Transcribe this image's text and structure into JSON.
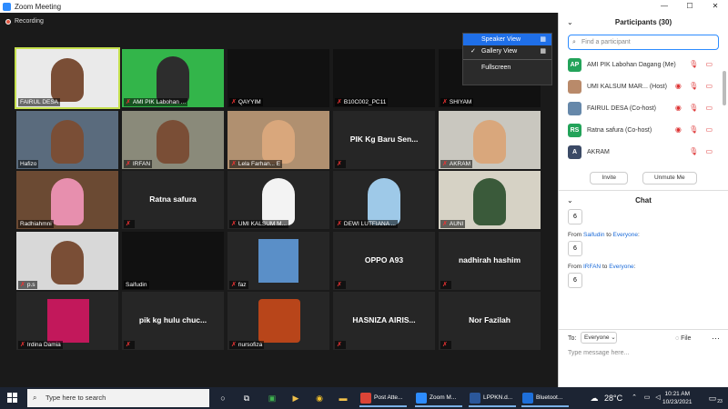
{
  "window": {
    "title": "Zoom Meeting",
    "minimize": "—",
    "maximize": "☐",
    "close": "✕"
  },
  "recording": {
    "label": "Recording"
  },
  "view_menu": {
    "items": [
      {
        "label": "Speaker View",
        "selected": true,
        "checked": false,
        "icon": "▦"
      },
      {
        "label": "Gallery View",
        "selected": false,
        "checked": true,
        "icon": "▦"
      },
      {
        "label": "Fullscreen",
        "selected": false,
        "checked": false,
        "icon": ""
      }
    ]
  },
  "tiles": [
    {
      "name": "FAIRUL DESA",
      "muted": false,
      "center": "",
      "active": true
    },
    {
      "name": "AMI PIK Labohan ...",
      "muted": true,
      "center": ""
    },
    {
      "name": "QAYYIM",
      "muted": true,
      "center": ""
    },
    {
      "name": "B10C002_PC11",
      "muted": true,
      "center": ""
    },
    {
      "name": "SHIYAM",
      "muted": true,
      "center": ""
    },
    {
      "name": "Hafizo",
      "muted": false,
      "center": ""
    },
    {
      "name": "IRFAN",
      "muted": true,
      "center": ""
    },
    {
      "name": "Lela Farhan...  E",
      "muted": true,
      "center": ""
    },
    {
      "name": "",
      "muted": true,
      "center": "PIK Kg Baru Sen..."
    },
    {
      "name": "AKRAM",
      "muted": true,
      "center": ""
    },
    {
      "name": "Radhiahmni",
      "muted": false,
      "center": ""
    },
    {
      "name": "",
      "muted": true,
      "center": "Ratna safura"
    },
    {
      "name": "UMI KALSUM M...",
      "muted": true,
      "center": ""
    },
    {
      "name": "DEWI LUTFIANA ...",
      "muted": true,
      "center": ""
    },
    {
      "name": "AUNI",
      "muted": true,
      "center": ""
    },
    {
      "name": "p.s",
      "muted": true,
      "center": ""
    },
    {
      "name": "Saifudin",
      "muted": false,
      "center": ""
    },
    {
      "name": "faz",
      "muted": true,
      "center": ""
    },
    {
      "name": "",
      "muted": true,
      "center": "OPPO A93"
    },
    {
      "name": "",
      "muted": true,
      "center": "nadhirah hashim"
    },
    {
      "name": "Irdina Damia",
      "muted": true,
      "center": ""
    },
    {
      "name": "",
      "muted": true,
      "center": "pik kg hulu chuc..."
    },
    {
      "name": "nursofiza",
      "muted": true,
      "center": ""
    },
    {
      "name": "",
      "muted": true,
      "center": "HASNIZA AIRIS..."
    },
    {
      "name": "",
      "muted": true,
      "center": "Nor Fazilah"
    }
  ],
  "participants": {
    "title": "Participants (30)",
    "search_placeholder": "Find a participant",
    "list": [
      {
        "initials": "AP",
        "color": "#23a35a",
        "name": "AMI PIK Labohan Dagang (Me)",
        "icons": "🎙 ▭"
      },
      {
        "initials": "",
        "color": "#b98a6a",
        "name": "UMI KALSUM MAR... (Host)",
        "icons": "◉ 🎙 ▭"
      },
      {
        "initials": "",
        "color": "#6688aa",
        "name": "FAIRUL DESA (Co-host)",
        "icons": "◉ 🎙 ▭"
      },
      {
        "initials": "RS",
        "color": "#23a35a",
        "name": "Ratna safura (Co-host)",
        "icons": "◉ 🎙 ▭"
      },
      {
        "initials": "A",
        "color": "#3b4a66",
        "name": "AKRAM",
        "icons": "🎙 ▭"
      }
    ],
    "invite_label": "Invite",
    "unmute_label": "Unmute Me"
  },
  "chat": {
    "title": "Chat",
    "messages": [
      {
        "from": "",
        "to": "",
        "text": "6"
      },
      {
        "from": "Saifudin",
        "to": "Everyone",
        "text": "6"
      },
      {
        "from": "IRFAN",
        "to": "Everyone",
        "text": "6"
      }
    ],
    "from_word": "From",
    "to_word": "to",
    "to_label": "To:",
    "recipient": "Everyone",
    "file_label": "File",
    "placeholder": "Type message here..."
  },
  "taskbar": {
    "search_placeholder": "Type here to search",
    "apps": [
      {
        "label": "Post Atte...",
        "color": "#db4437"
      },
      {
        "label": "Zoom M...",
        "color": "#2d8cff"
      },
      {
        "label": "LPPKN.d...",
        "color": "#2b579a"
      },
      {
        "label": "Bluetoot...",
        "color": "#1e6fd9"
      }
    ],
    "temperature": "28°C",
    "time": "10:21 AM",
    "date": "10/23/2021",
    "notifications": "23"
  }
}
